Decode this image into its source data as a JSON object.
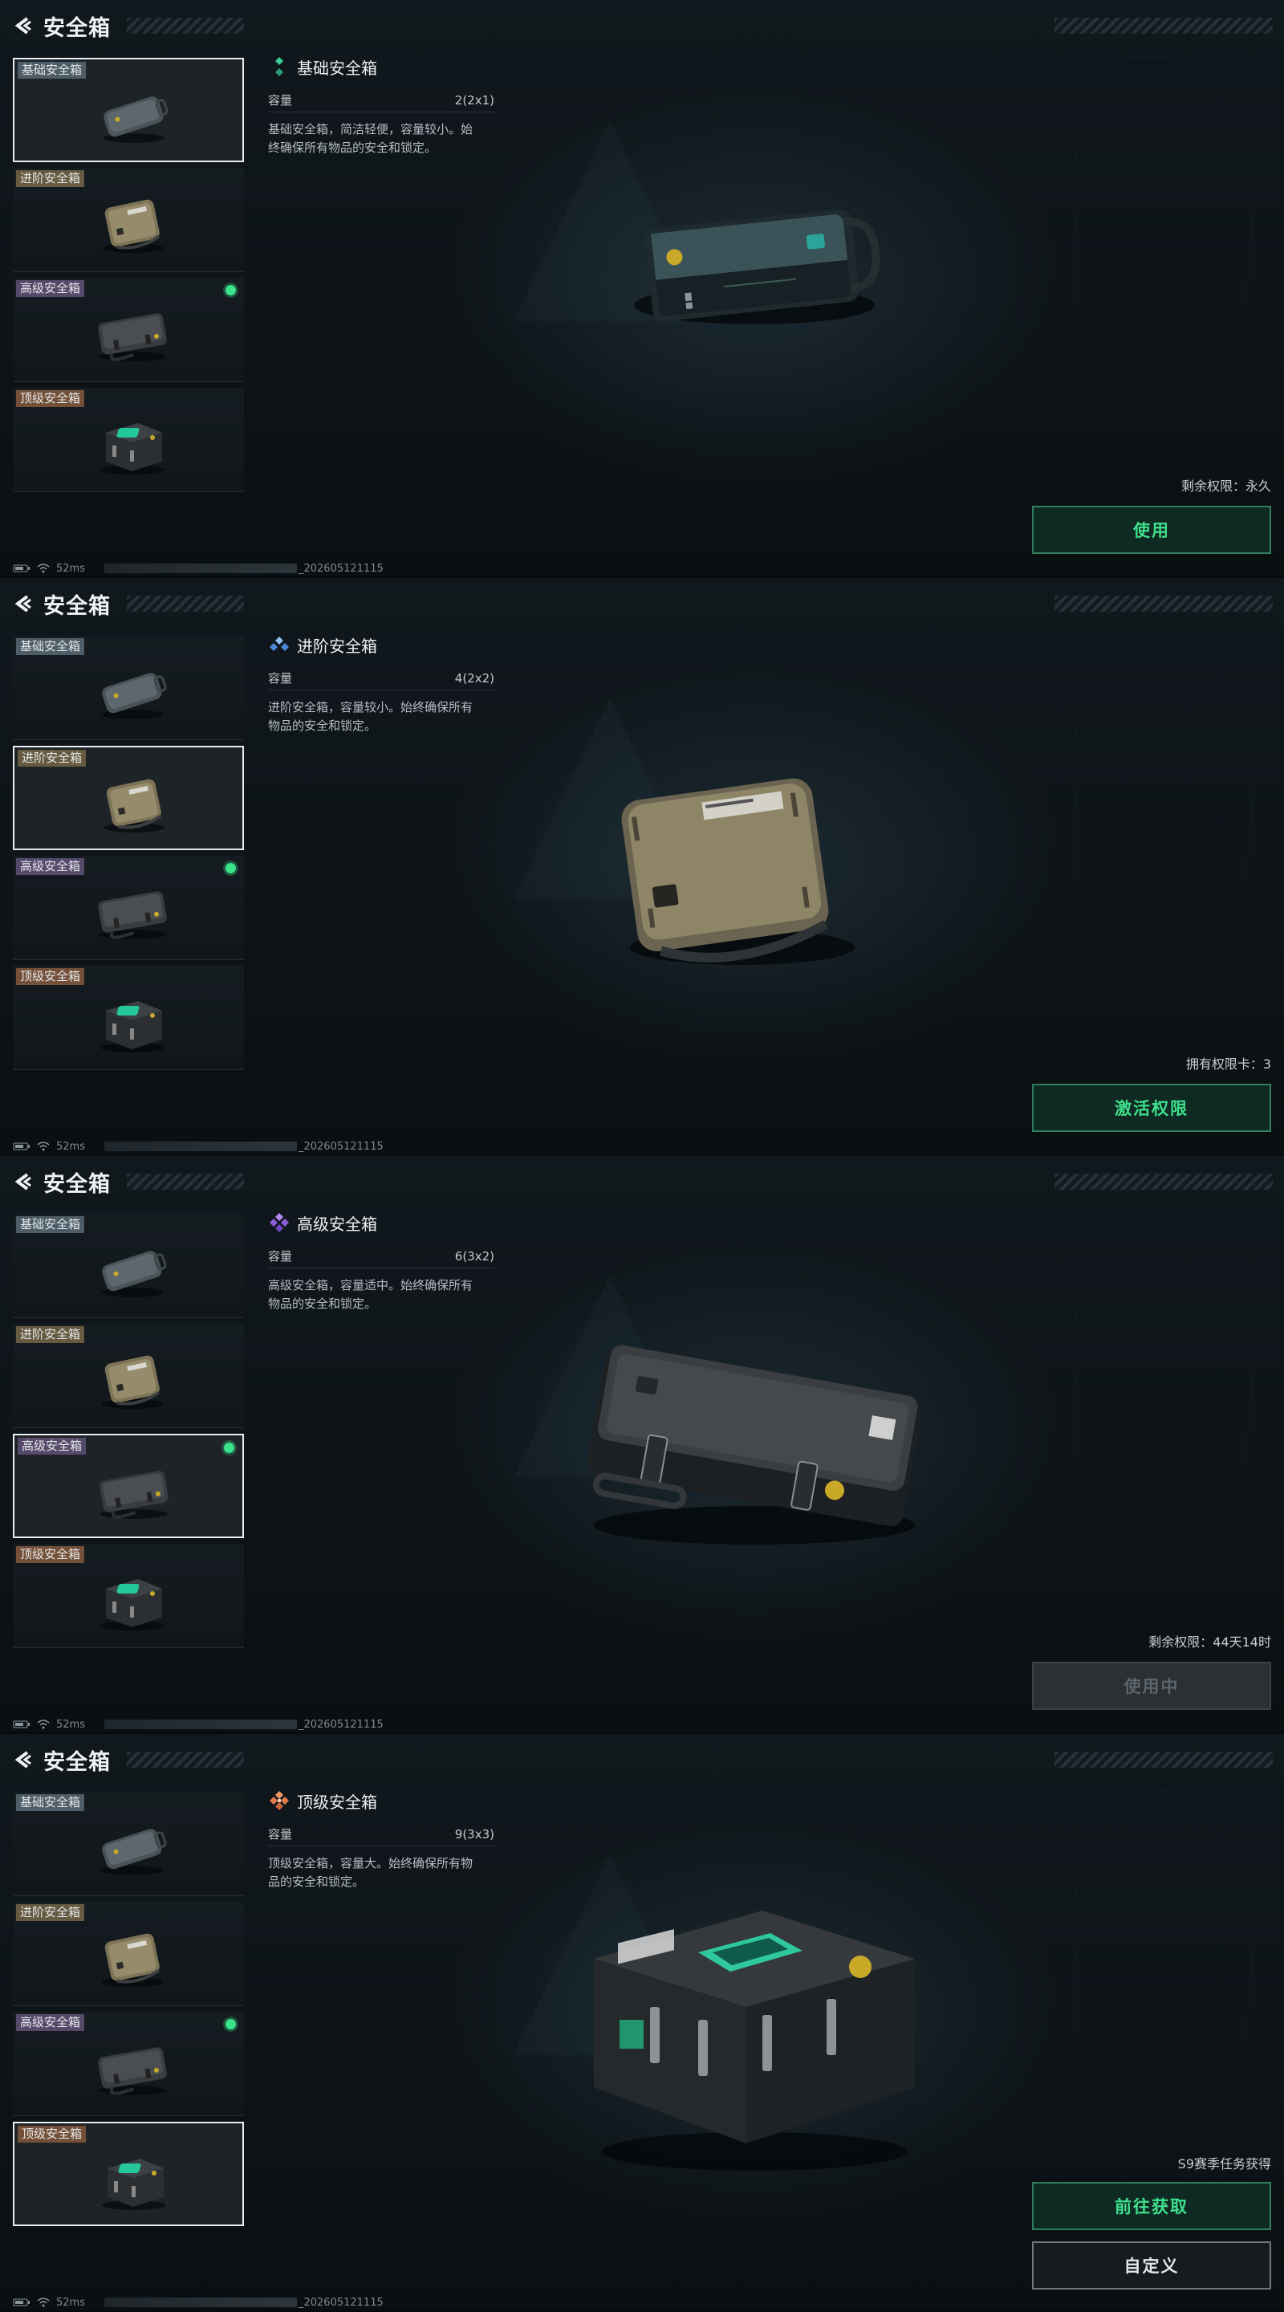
{
  "page_title": "安全箱",
  "case_labels": {
    "basic": "基础安全箱",
    "advanced": "进阶安全箱",
    "senior": "高级安全箱",
    "top": "顶级安全箱"
  },
  "capacity_label": "容量",
  "status_bar": {
    "ping": "52ms",
    "build": "_202605121115"
  },
  "colors": {
    "accent_green": "#3ee08c",
    "rarity_basic": "#3ccf95",
    "rarity_advanced": "#5b9ee6",
    "rarity_senior": "#9a6de0",
    "rarity_top": "#e27c4c"
  },
  "icons": {
    "back": "back-arrow-icon",
    "wifi": "wifi-icon",
    "battery": "battery-icon",
    "active": "active-dot-icon"
  },
  "panels": [
    {
      "name": "基础安全箱",
      "capacity": "2(2x1)",
      "description_lines": [
        "基础安全箱，简洁轻便，容量较小。始",
        "终确保所有物品的安全和锁定。"
      ],
      "info": "剩余权限：永久",
      "buttons": [
        "使用"
      ]
    },
    {
      "name": "进阶安全箱",
      "capacity": "4(2x2)",
      "description_lines": [
        "进阶安全箱，容量较小。始终确保所有",
        "物品的安全和锁定。"
      ],
      "info": "拥有权限卡：3",
      "buttons": [
        "激活权限"
      ]
    },
    {
      "name": "高级安全箱",
      "capacity": "6(3x2)",
      "description_lines": [
        "高级安全箱，容量适中。始终确保所有",
        "物品的安全和锁定。"
      ],
      "info": "剩余权限：44天14时",
      "buttons": [
        "使用中"
      ]
    },
    {
      "name": "顶级安全箱",
      "capacity": "9(3x3)",
      "description_lines": [
        "顶级安全箱，容量大。始终确保所有物",
        "品的安全和锁定。"
      ],
      "info": "S9赛季任务获得",
      "buttons": [
        "前往获取",
        "自定义"
      ]
    }
  ]
}
